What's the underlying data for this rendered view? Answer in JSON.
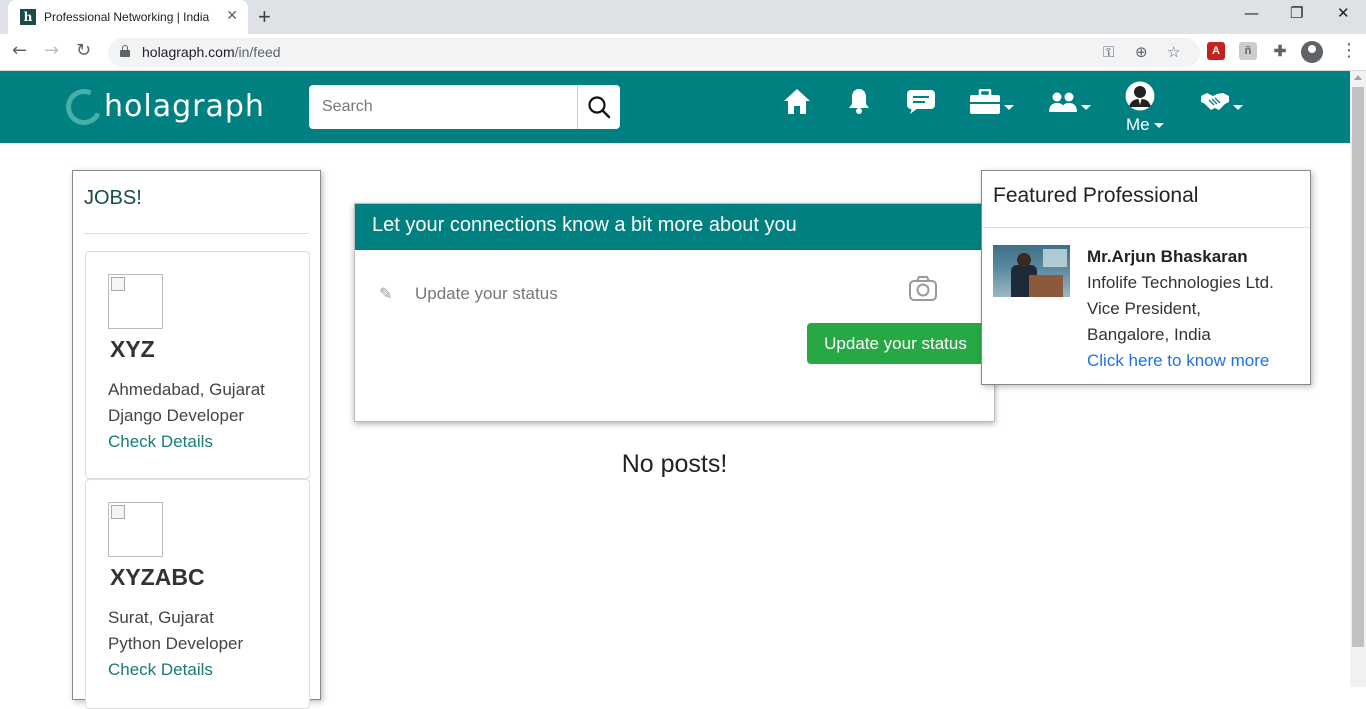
{
  "browser": {
    "tab_title": "Professional Networking | India C",
    "tab_favicon": "h",
    "url_domain": "holagraph.com",
    "url_path": "/in/feed"
  },
  "header": {
    "logo_text": "holagraph",
    "search_placeholder": "Search",
    "me_label": "Me",
    "brand_color": "#008080",
    "icons": [
      "home-icon",
      "bell-icon",
      "chat-icon",
      "briefcase-icon",
      "people-icon",
      "user-avatar-icon",
      "handshake-icon"
    ]
  },
  "jobs": {
    "title": "JOBS!",
    "items": [
      {
        "name": "XYZ",
        "location": "Ahmedabad, Gujarat",
        "role": "Django Developer",
        "link": "Check Details"
      },
      {
        "name": "XYZABC",
        "location": "Surat, Gujarat",
        "role": "Python Developer",
        "link": "Check Details"
      }
    ]
  },
  "status": {
    "header": "Let your connections know a bit more about you",
    "placeholder": "Update your status",
    "button": "Update your status"
  },
  "feed": {
    "empty_text": "No posts!"
  },
  "featured": {
    "title": "Featured Professional",
    "name": "Mr.Arjun Bhaskaran",
    "company": "Infolife Technologies Ltd.",
    "position": "Vice President,",
    "location": "Bangalore, India",
    "link": "Click here to know more"
  }
}
